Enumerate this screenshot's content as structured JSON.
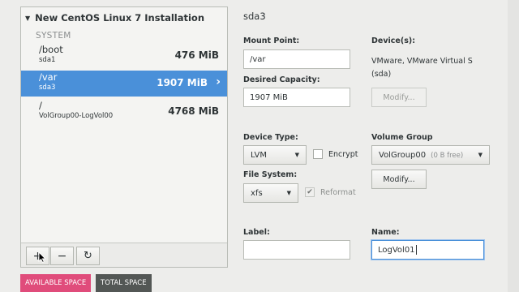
{
  "left": {
    "header": "New CentOS Linux 7 Installation",
    "section": "SYSTEM",
    "mounts": [
      {
        "name": "/boot",
        "device": "sda1",
        "size": "476 MiB",
        "selected": false
      },
      {
        "name": "/var",
        "device": "sda3",
        "size": "1907 MiB",
        "selected": true
      },
      {
        "name": "/",
        "device": "VolGroup00-LogVol00",
        "size": "4768 MiB",
        "selected": false
      }
    ],
    "toolbar": {
      "add": "+",
      "remove": "−",
      "refresh": "↻"
    }
  },
  "space": {
    "available_label": "AVAILABLE SPACE",
    "total_label": "TOTAL SPACE"
  },
  "detail": {
    "title": "sda3",
    "mount_point_label": "Mount Point:",
    "mount_point_value": "/var",
    "desired_capacity_label": "Desired Capacity:",
    "desired_capacity_value": "1907 MiB",
    "devices_label": "Device(s):",
    "devices_value_line1": "VMware, VMware Virtual S",
    "devices_value_line2": "(sda)",
    "modify_label": "Modify...",
    "device_type_label": "Device Type:",
    "device_type_value": "LVM",
    "encrypt_label": "Encrypt",
    "volume_group_label": "Volume Group",
    "volume_group_value": "VolGroup00",
    "volume_group_free": "(0 B free)",
    "vg_modify_label": "Modify...",
    "file_system_label": "File System:",
    "file_system_value": "xfs",
    "reformat_label": "Reformat",
    "label_label": "Label:",
    "label_value": "",
    "name_label": "Name:",
    "name_value": "LogVol01"
  },
  "colors": {
    "selected": "#4a90d9",
    "available_space": "#e04c7b",
    "total_space": "#535755"
  }
}
